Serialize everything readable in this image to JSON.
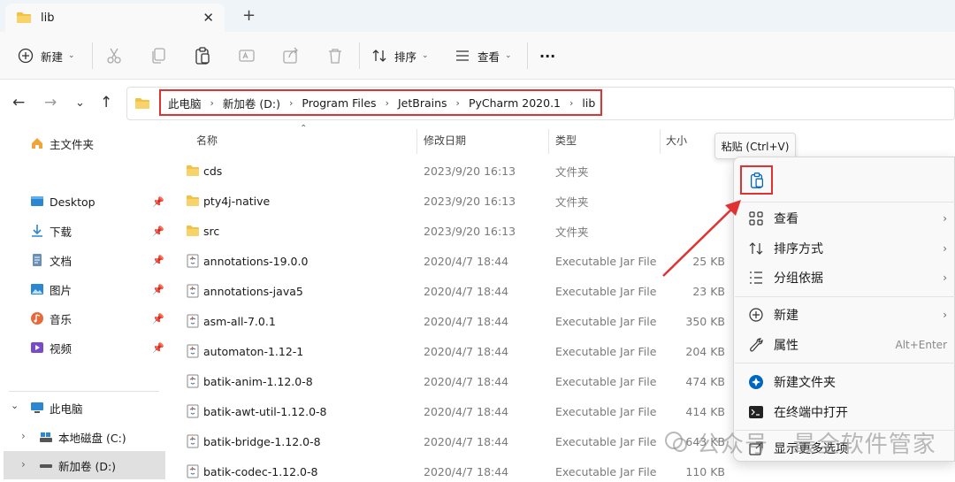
{
  "window": {
    "tab_title": "lib",
    "new_tab_label": "+",
    "close_label": "✕"
  },
  "toolbar": {
    "new_label": "新建",
    "sort_label": "排序",
    "view_label": "查看",
    "more_label": "···"
  },
  "address": {
    "crumbs": [
      "此电脑",
      "新加卷 (D:)",
      "Program Files",
      "JetBrains",
      "PyCharm 2020.1",
      "lib"
    ]
  },
  "sidebar": {
    "home": "主文件夹",
    "quick": [
      {
        "label": "Desktop",
        "icon": "desktop-icon"
      },
      {
        "label": "下载",
        "icon": "download-icon"
      },
      {
        "label": "文档",
        "icon": "document-icon"
      },
      {
        "label": "图片",
        "icon": "picture-icon"
      },
      {
        "label": "音乐",
        "icon": "music-icon"
      },
      {
        "label": "视频",
        "icon": "video-icon"
      }
    ],
    "this_pc": "此电脑",
    "drives": [
      {
        "label": "本地磁盘 (C:)"
      },
      {
        "label": "新加卷 (D:)"
      }
    ]
  },
  "columns": {
    "name": "名称",
    "date": "修改日期",
    "type": "类型",
    "size": "大小"
  },
  "files": [
    {
      "name": "cds",
      "date": "2023/9/20 16:13",
      "type": "文件夹",
      "size": "",
      "kind": "folder"
    },
    {
      "name": "pty4j-native",
      "date": "2023/9/20 16:13",
      "type": "文件夹",
      "size": "",
      "kind": "folder"
    },
    {
      "name": "src",
      "date": "2023/9/20 16:13",
      "type": "文件夹",
      "size": "",
      "kind": "folder"
    },
    {
      "name": "annotations-19.0.0",
      "date": "2020/4/7 18:44",
      "type": "Executable Jar File",
      "size": "25 KB",
      "kind": "jar"
    },
    {
      "name": "annotations-java5",
      "date": "2020/4/7 18:44",
      "type": "Executable Jar File",
      "size": "23 KB",
      "kind": "jar"
    },
    {
      "name": "asm-all-7.0.1",
      "date": "2020/4/7 18:44",
      "type": "Executable Jar File",
      "size": "350 KB",
      "kind": "jar"
    },
    {
      "name": "automaton-1.12-1",
      "date": "2020/4/7 18:44",
      "type": "Executable Jar File",
      "size": "204 KB",
      "kind": "jar"
    },
    {
      "name": "batik-anim-1.12.0-8",
      "date": "2020/4/7 18:44",
      "type": "Executable Jar File",
      "size": "474 KB",
      "kind": "jar"
    },
    {
      "name": "batik-awt-util-1.12.0-8",
      "date": "2020/4/7 18:44",
      "type": "Executable Jar File",
      "size": "414 KB",
      "kind": "jar"
    },
    {
      "name": "batik-bridge-1.12.0-8",
      "date": "2020/4/7 18:44",
      "type": "Executable Jar File",
      "size": "643 KB",
      "kind": "jar"
    },
    {
      "name": "batik-codec-1.12.0-8",
      "date": "2020/4/7 18:44",
      "type": "Executable Jar File",
      "size": "110 KB",
      "kind": "jar"
    }
  ],
  "context_menu": {
    "tooltip": "粘贴 (Ctrl+V)",
    "items": [
      {
        "label": "查看",
        "icon": "grid-icon",
        "submenu": true,
        "accel": ""
      },
      {
        "label": "排序方式",
        "icon": "sort-icon",
        "submenu": true,
        "accel": ""
      },
      {
        "label": "分组依据",
        "icon": "group-icon",
        "submenu": true,
        "accel": ""
      },
      {
        "label": "新建",
        "icon": "plus-circle-icon",
        "submenu": true,
        "accel": ""
      },
      {
        "label": "属性",
        "icon": "wrench-icon",
        "submenu": false,
        "accel": "Alt+Enter"
      },
      {
        "label": "新建文件夹",
        "icon": "new-folder-icon",
        "submenu": false,
        "accel": ""
      },
      {
        "label": "在终端中打开",
        "icon": "terminal-icon",
        "submenu": false,
        "accel": ""
      },
      {
        "label": "显示更多选项",
        "icon": "more-options-icon",
        "submenu": false,
        "accel": ""
      }
    ]
  },
  "watermark": {
    "text": "公众号 · 最全软件管家"
  },
  "colors": {
    "accent": "#0067c0",
    "highlight": "#e03232",
    "folder": "#f3c244"
  }
}
